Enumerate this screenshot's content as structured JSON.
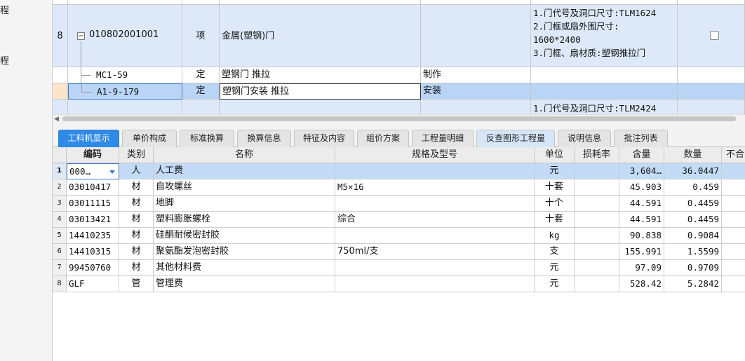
{
  "left_nav": {
    "item1": "程",
    "item2": "程"
  },
  "upper_grid": {
    "row8": {
      "num": "8",
      "code": "010802001001",
      "type": "项",
      "name": "金属(塑钢)门",
      "features": [
        "1.门代号及洞口尺寸:TLM1624",
        "2.门框或扇外围尺寸:",
        "1600*2400",
        "3.门框、扇材质:塑钢推拉门"
      ]
    },
    "sub1": {
      "code": "MC1-59",
      "type": "定",
      "name": "塑钢门 推拉",
      "content": "制作"
    },
    "sub2": {
      "code": "A1-9-179",
      "type": "定",
      "name": "塑钢门安装 推拉",
      "content": "安装"
    },
    "next_feature": "1.门代号及洞口尺寸:TLM2424"
  },
  "tabs": [
    "工料机显示",
    "单价构成",
    "标准换算",
    "换算信息",
    "特征及内容",
    "组价方案",
    "工程量明细",
    "反查图形工程量",
    "说明信息",
    "批注列表"
  ],
  "lower_grid": {
    "headers": {
      "code": "编码",
      "category": "类别",
      "name": "名称",
      "spec": "规格及型号",
      "unit": "单位",
      "loss": "损耗率",
      "content": "含量",
      "quantity": "数量",
      "extra": "不合"
    },
    "rows": [
      {
        "num": "1",
        "code": "000…",
        "category": "人",
        "name": "人工费",
        "spec": "",
        "unit": "元",
        "loss": "",
        "content": "3,604…",
        "quantity": "36.0447"
      },
      {
        "num": "2",
        "code": "03010417",
        "category": "材",
        "name": "自攻螺丝",
        "spec": "M5×16",
        "unit": "十套",
        "loss": "",
        "content": "45.903",
        "quantity": "0.459"
      },
      {
        "num": "3",
        "code": "03011115",
        "category": "材",
        "name": "地脚",
        "spec": "",
        "unit": "十个",
        "loss": "",
        "content": "44.591",
        "quantity": "0.4459"
      },
      {
        "num": "4",
        "code": "03013421",
        "category": "材",
        "name": "塑料膨胀螺栓",
        "spec": "综合",
        "unit": "十套",
        "loss": "",
        "content": "44.591",
        "quantity": "0.4459"
      },
      {
        "num": "5",
        "code": "14410235",
        "category": "材",
        "name": "硅酮耐候密封胶",
        "spec": "",
        "unit": "kg",
        "loss": "",
        "content": "90.838",
        "quantity": "0.9084"
      },
      {
        "num": "6",
        "code": "14410315",
        "category": "材",
        "name": "聚氨酯发泡密封胶",
        "spec": "750ml/支",
        "unit": "支",
        "loss": "",
        "content": "155.991",
        "quantity": "1.5599"
      },
      {
        "num": "7",
        "code": "99450760",
        "category": "材",
        "name": "其他材料费",
        "spec": "",
        "unit": "元",
        "loss": "",
        "content": "97.09",
        "quantity": "0.9709"
      },
      {
        "num": "8",
        "code": "GLF",
        "category": "管",
        "name": "管理费",
        "spec": "",
        "unit": "元",
        "loss": "",
        "content": "528.42",
        "quantity": "5.2842"
      }
    ]
  }
}
